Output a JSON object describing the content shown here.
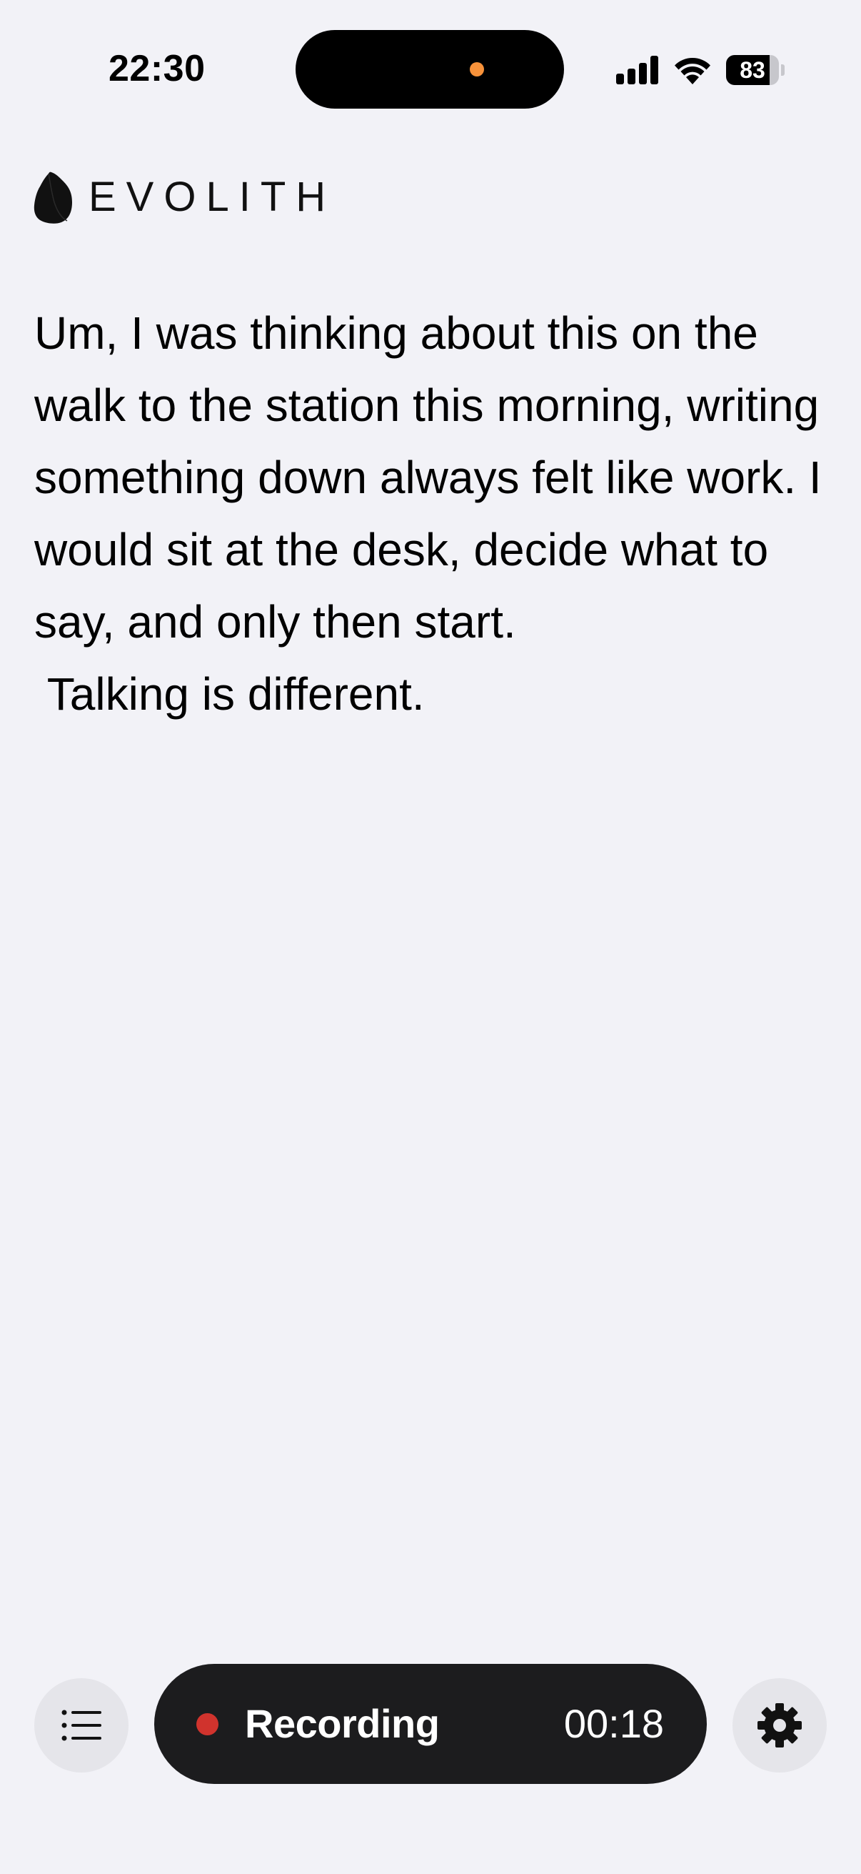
{
  "status_bar": {
    "time": "22:30",
    "battery_level": "83",
    "battery_fraction": 0.83
  },
  "header": {
    "brand_name": "EVOLITH"
  },
  "transcript": {
    "text": "Um, I was thinking about this on the walk to the station this morning, writing something down always felt like work. I would sit at the desk, decide what to say, and only then start.\n Talking is different."
  },
  "controls": {
    "recording_label": "Recording",
    "timer": "00:18",
    "list_icon": "list-icon",
    "settings_icon": "gear-icon"
  },
  "colors": {
    "background": "#f2f2f7",
    "pill": "#1c1c1e",
    "record_dot": "#d0332d",
    "island_indicator": "#f7923a",
    "button_bg": "#e5e5ea"
  }
}
